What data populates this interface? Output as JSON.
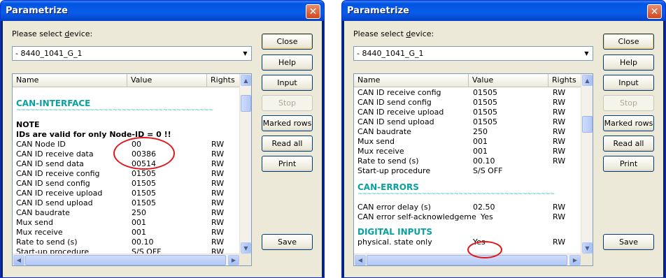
{
  "windows": [
    {
      "title": "Parametrize",
      "select_label_pre": "Please select ",
      "select_label_u": "d",
      "select_label_post": "evice:",
      "device": "- 8440_1041_G_1",
      "columns": [
        "Name",
        "Value",
        "Rights"
      ],
      "buttons": [
        "Close",
        "Help",
        "Input",
        "Stop",
        "Marked rows",
        "Read all",
        "Print",
        "Save"
      ],
      "section1": "CAN-INTERFACE",
      "wave": "~~~~~~~~~~~~~~~~~~~~~~~~~~~~~~~~~~~~~~~~~~~",
      "note_title": "NOTE",
      "note_text": "IDs are valid for only Node-ID = 0 !!",
      "rows": [
        {
          "name": "CAN Node ID",
          "value": "00",
          "rights": "RW"
        },
        {
          "name": "CAN ID receive data",
          "value": "00386",
          "rights": "RW"
        },
        {
          "name": "CAN ID send data",
          "value": "00514",
          "rights": "RW"
        },
        {
          "name": "CAN ID receive config",
          "value": "01505",
          "rights": "RW"
        },
        {
          "name": "CAN ID send config",
          "value": "01505",
          "rights": "RW"
        },
        {
          "name": "CAN ID receive upload",
          "value": "01505",
          "rights": "RW"
        },
        {
          "name": "CAN ID send upload",
          "value": "01505",
          "rights": "RW"
        },
        {
          "name": "CAN baudrate",
          "value": "250",
          "rights": "RW"
        },
        {
          "name": "Mux send",
          "value": "001",
          "rights": "RW"
        },
        {
          "name": "Mux receive",
          "value": "001",
          "rights": "RW"
        },
        {
          "name": "Rate to send (s)",
          "value": "00.10",
          "rights": "RW"
        },
        {
          "name": "Start-up procedure",
          "value": "S/S OFF",
          "rights": "RW"
        }
      ]
    },
    {
      "title": "Parametrize",
      "select_label_pre": "Please select ",
      "select_label_u": "d",
      "select_label_post": "evice:",
      "device": "- 8440_1041_G_1",
      "columns": [
        "Name",
        "Value",
        "Rights"
      ],
      "buttons": [
        "Close",
        "Help",
        "Input",
        "Stop",
        "Marked rows",
        "Read all",
        "Print",
        "Save"
      ],
      "rows": [
        {
          "name": "CAN ID receive config",
          "value": "01505",
          "rights": "RW"
        },
        {
          "name": "CAN ID send config",
          "value": "01505",
          "rights": "RW"
        },
        {
          "name": "CAN ID receive upload",
          "value": "01505",
          "rights": "RW"
        },
        {
          "name": "CAN ID send upload",
          "value": "01505",
          "rights": "RW"
        },
        {
          "name": "CAN baudrate",
          "value": "250",
          "rights": "RW"
        },
        {
          "name": "Mux send",
          "value": "001",
          "rights": "RW"
        },
        {
          "name": "Mux receive",
          "value": "001",
          "rights": "RW"
        },
        {
          "name": "Rate to send (s)",
          "value": "00.10",
          "rights": "RW"
        },
        {
          "name": "Start-up procedure",
          "value": "S/S OFF",
          "rights": ""
        }
      ],
      "section2": "CAN-ERRORS",
      "wave": "~~~~~~~~~~~~~~~~~~~~~~~~~~~~~~~~~~~~~~~~~~~",
      "rows2": [
        {
          "name": "CAN error delay (s)",
          "value": "02.50",
          "rights": "RW"
        },
        {
          "name": "CAN error self-acknowledgement",
          "value": "Yes",
          "rights": "RW"
        }
      ],
      "section3": "DIGITAL INPUTS",
      "rows3": [
        {
          "name": "physical. state only",
          "value": "Yes",
          "rights": "RW"
        }
      ]
    }
  ],
  "colors": {
    "section": "#0aa0a0",
    "highlight_circle": "#e0161b",
    "titlebar": "#0054e3"
  }
}
